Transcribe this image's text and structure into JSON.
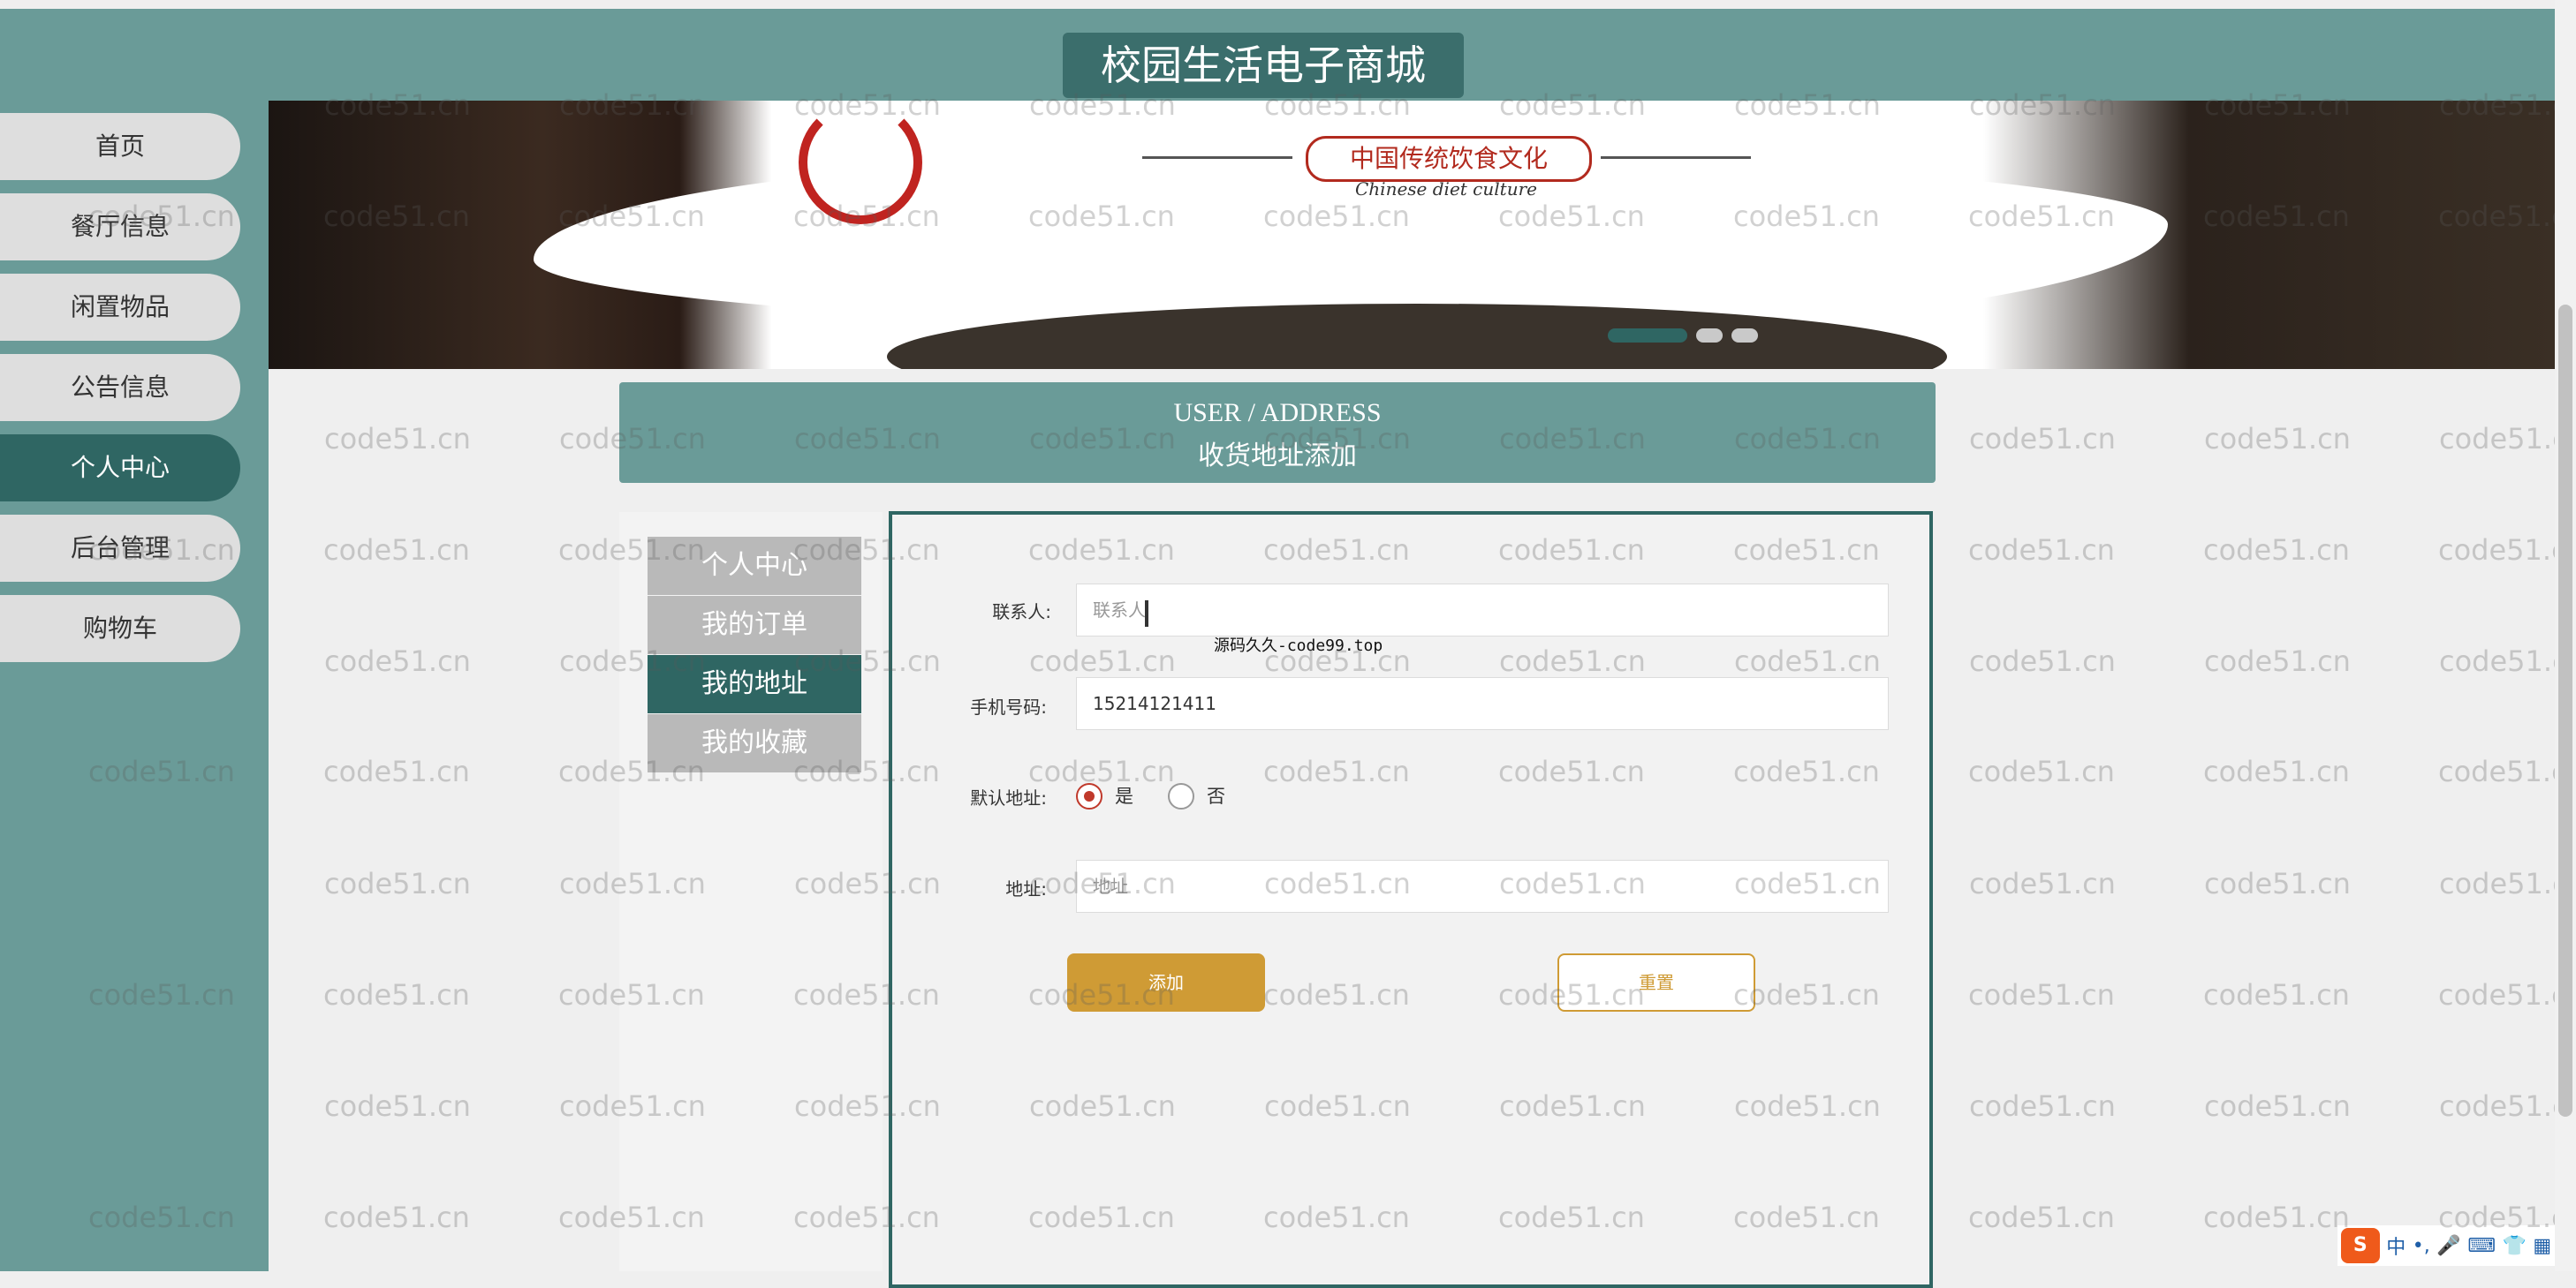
{
  "site": {
    "title": "校园生活电子商城"
  },
  "nav": {
    "items": [
      {
        "label": "首页"
      },
      {
        "label": "餐厅信息"
      },
      {
        "label": "闲置物品"
      },
      {
        "label": "公告信息"
      },
      {
        "label": "个人中心"
      },
      {
        "label": "后台管理"
      },
      {
        "label": "购物车"
      }
    ]
  },
  "banner": {
    "title": "中国传统饮食文化",
    "subtitle": "Chinese diet culture"
  },
  "page_header": {
    "en": "USER / ADDRESS",
    "cn": "收货地址添加"
  },
  "sidebar": {
    "items": [
      {
        "label": "个人中心"
      },
      {
        "label": "我的订单"
      },
      {
        "label": "我的地址"
      },
      {
        "label": "我的收藏"
      }
    ]
  },
  "form": {
    "contact_label": "联系人:",
    "contact_placeholder": "联系人",
    "phone_label": "手机号码:",
    "phone_value": "15214121411",
    "default_label": "默认地址:",
    "yes": "是",
    "no": "否",
    "address_label": "地址:",
    "address_placeholder": "地址",
    "add_button": "添加",
    "reset_button": "重置"
  },
  "tooltip": "源码久久-code99.top",
  "watermark": "code51.cn",
  "tray": {
    "ime": "中",
    "punct": "•,"
  }
}
